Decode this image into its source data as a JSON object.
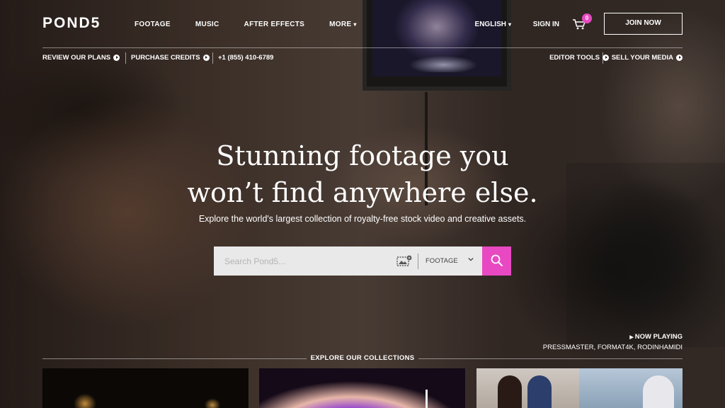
{
  "brand": {
    "logo": "POND5",
    "accent": "#e849c2"
  },
  "nav": {
    "links": [
      "FOOTAGE",
      "MUSIC",
      "AFTER EFFECTS",
      "MORE"
    ],
    "language": "ENGLISH",
    "sign_in": "SIGN IN",
    "cart_count": "0",
    "join": "JOIN NOW"
  },
  "subnav": {
    "left": [
      "REVIEW OUR PLANS",
      "PURCHASE CREDITS",
      "+1 (855) 410-6789"
    ],
    "right": [
      "EDITOR TOOLS",
      "SELL YOUR MEDIA"
    ]
  },
  "hero": {
    "headline_1": "Stunning footage you",
    "headline_2": "won’t find anywhere else.",
    "subline": "Explore the world's largest collection of royalty-free stock video and creative assets."
  },
  "search": {
    "placeholder": "Search Pond5...",
    "type_selected": "FOOTAGE"
  },
  "now_playing": {
    "title": "NOW PLAYING",
    "credits": "PRESSMASTER, FORMAT4K, RODINHAMIDI"
  },
  "collections": {
    "label": "EXPLORE OUR COLLECTIONS"
  },
  "icons": [
    "chevron-down-icon",
    "cart-icon",
    "play-circle-icon",
    "image-search-icon",
    "search-icon",
    "play-triangle-icon"
  ]
}
